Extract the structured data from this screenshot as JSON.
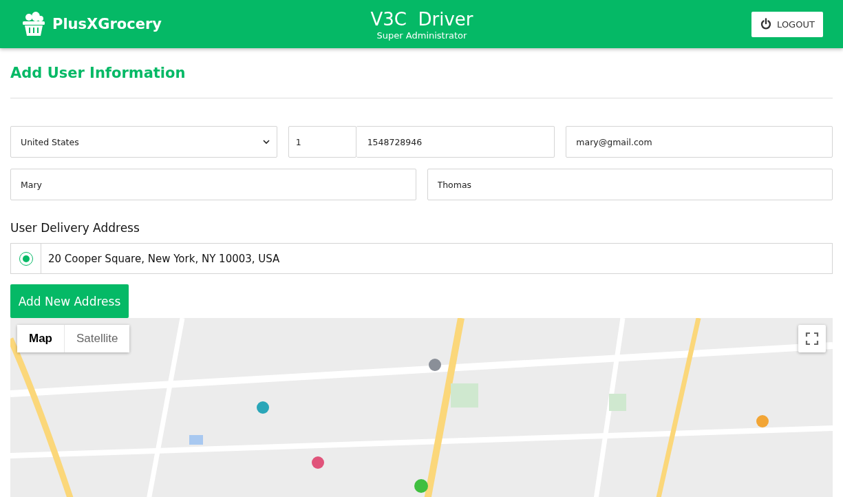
{
  "header": {
    "brand": "PlusXGrocery",
    "title": "V3C  Driver",
    "subtitle": "Super Administrator",
    "logout": "LOGOUT"
  },
  "page_title": "Add User Information",
  "form": {
    "country": "United States",
    "country_code": "1",
    "phone": "1548728946",
    "email": "mary@gmail.com",
    "first_name": "Mary",
    "last_name": "Thomas"
  },
  "address_section": {
    "heading": "User Delivery Address",
    "addresses": [
      {
        "text": "20 Cooper Square, New York, NY 10003, USA",
        "selected": true
      }
    ],
    "add_button": "Add New Address"
  },
  "map": {
    "map_types": [
      {
        "label": "Map",
        "selected": true
      },
      {
        "label": "Satellite",
        "selected": false
      }
    ]
  }
}
